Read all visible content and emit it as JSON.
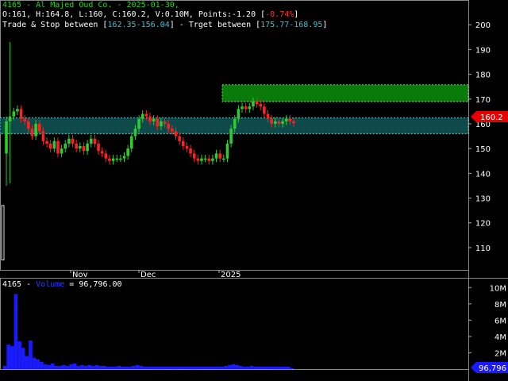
{
  "header": {
    "line1": "4165 - Al Majed Oud Co. - 2025-01-30,",
    "line2_prefix": "O:161, H:164.8, L:160, C:160.2, V:0.10M, Points:-1.20 [",
    "line2_pct": "-0.74%",
    "line2_suffix": "]",
    "line3_a": "Trade & Stop between [",
    "line3_range1": "162.35-156.04",
    "line3_b": "] - Trget between [",
    "line3_range2": "175.77-168.95",
    "line3_c": "]"
  },
  "volume_header": {
    "prefix": "4165 - ",
    "label": "Volume",
    "value": " = 96,796.00"
  },
  "price_badge": "160.2",
  "volume_badge": "96,796",
  "colors": {
    "up": "#2ecc2e",
    "down": "#ff2020",
    "target_zone": "#0a7a0a",
    "trade_zone": "#0e4a4a",
    "volume": "#1a1aff",
    "badge": "#e60000"
  },
  "chart_data": [
    {
      "type": "candlestick",
      "title": "4165 - Al Majed Oud Co. - 2025-01-30",
      "x_tick_labels": [
        "Nov",
        "Dec",
        "2025"
      ],
      "y_ticks": [
        110,
        120,
        130,
        140,
        150,
        160,
        170,
        180,
        190,
        200
      ],
      "ylim": [
        101,
        210
      ],
      "zones": [
        {
          "name": "Trade & Stop",
          "low": 156.04,
          "high": 162.35
        },
        {
          "name": "Target",
          "low": 168.95,
          "high": 175.77
        }
      ],
      "last_price": 160.2,
      "close": [
        161,
        163,
        165,
        166,
        162,
        161,
        158,
        155,
        160,
        157,
        153,
        152,
        150,
        153,
        148,
        150,
        152,
        154,
        152,
        150,
        151,
        149,
        152,
        154,
        152,
        149,
        148,
        146,
        145,
        146,
        146,
        146,
        147,
        150,
        155,
        158,
        162,
        164,
        163,
        161,
        162,
        159,
        161,
        160,
        158,
        157,
        155,
        153,
        151,
        150,
        148,
        146,
        145,
        146,
        146,
        145,
        146,
        148,
        146,
        146,
        152,
        158,
        162,
        166,
        167,
        166,
        167,
        169,
        168,
        167,
        164,
        162,
        160,
        161,
        160,
        161,
        162,
        161,
        160.2
      ],
      "grid": false
    },
    {
      "type": "bar",
      "title": "Volume",
      "y_ticks": [
        "2M",
        "4M",
        "6M",
        "8M",
        "10M"
      ],
      "ylim": [
        0,
        11
      ],
      "last_value": 96796,
      "values_millions": [
        0.4,
        3.0,
        2.8,
        9.2,
        3.4,
        2.6,
        1.6,
        3.5,
        1.4,
        1.2,
        0.9,
        0.6,
        0.5,
        0.7,
        0.4,
        0.4,
        0.5,
        0.4,
        0.6,
        0.7,
        0.4,
        0.5,
        0.4,
        0.5,
        0.4,
        0.5,
        0.4,
        0.4,
        0.3,
        0.3,
        0.3,
        0.4,
        0.3,
        0.3,
        0.3,
        0.4,
        0.5,
        0.4,
        0.3,
        0.3,
        0.3,
        0.3,
        0.3,
        0.3,
        0.3,
        0.3,
        0.3,
        0.3,
        0.3,
        0.3,
        0.3,
        0.3,
        0.3,
        0.3,
        0.3,
        0.3,
        0.3,
        0.3,
        0.3,
        0.3,
        0.4,
        0.5,
        0.6,
        0.5,
        0.4,
        0.3,
        0.3,
        0.4,
        0.3,
        0.3,
        0.3,
        0.3,
        0.3,
        0.3,
        0.3,
        0.3,
        0.3,
        0.3,
        0.1
      ]
    }
  ]
}
